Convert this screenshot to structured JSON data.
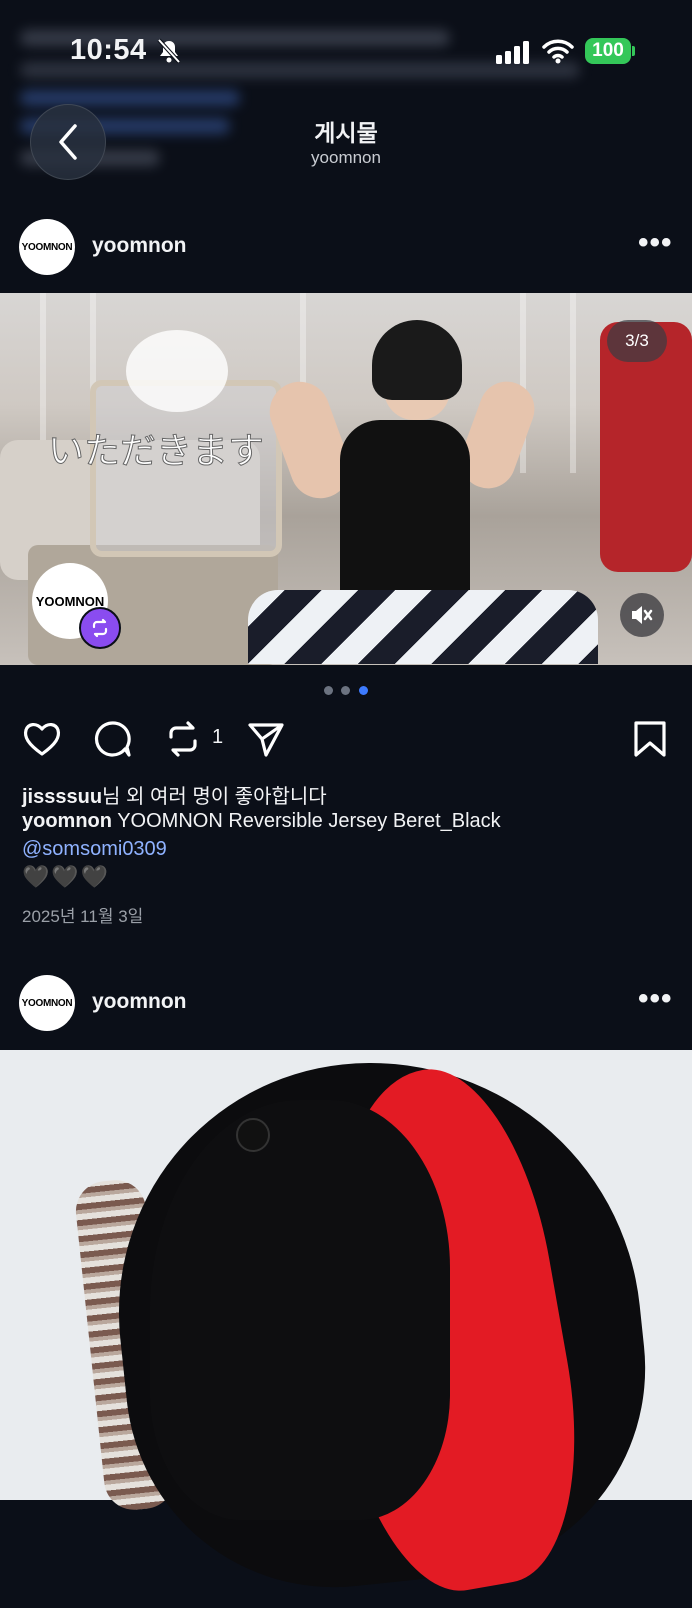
{
  "status_bar": {
    "time": "10:54",
    "battery": "100"
  },
  "nav": {
    "title": "게시물",
    "subtitle": "yoomnon"
  },
  "post1": {
    "username": "yoomnon",
    "avatar_text": "YOOMNON",
    "media": {
      "counter": "3/3",
      "overlay_text": "いただきます",
      "repost_avatar_text": "YOOMNON",
      "pagination": {
        "total": 3,
        "active": 3
      }
    },
    "repost_count": "1",
    "likes": {
      "user": "jissssuu",
      "rest": "님 외 여러 명이 좋아합니다"
    },
    "caption": {
      "user": "yoomnon",
      "text": "YOOMNON Reversible Jersey Beret_Black"
    },
    "mention": "@somsomi0309",
    "hearts": "🖤🖤🖤",
    "date": "2025년 11월 3일"
  },
  "post2": {
    "username": "yoomnon",
    "avatar_text": "YOOMNON"
  },
  "colors": {
    "background": "#0b0f18",
    "mention": "#8fb2ff",
    "battery": "#34c759",
    "repost_badge": "#8a4cf0",
    "pagination_active": "#3d7bff"
  },
  "icons": [
    "bell-slash-icon",
    "signal-icon",
    "wifi-icon",
    "back-icon",
    "more-icon",
    "heart-icon",
    "comment-icon",
    "repost-icon",
    "share-icon",
    "bookmark-icon",
    "mute-icon"
  ]
}
